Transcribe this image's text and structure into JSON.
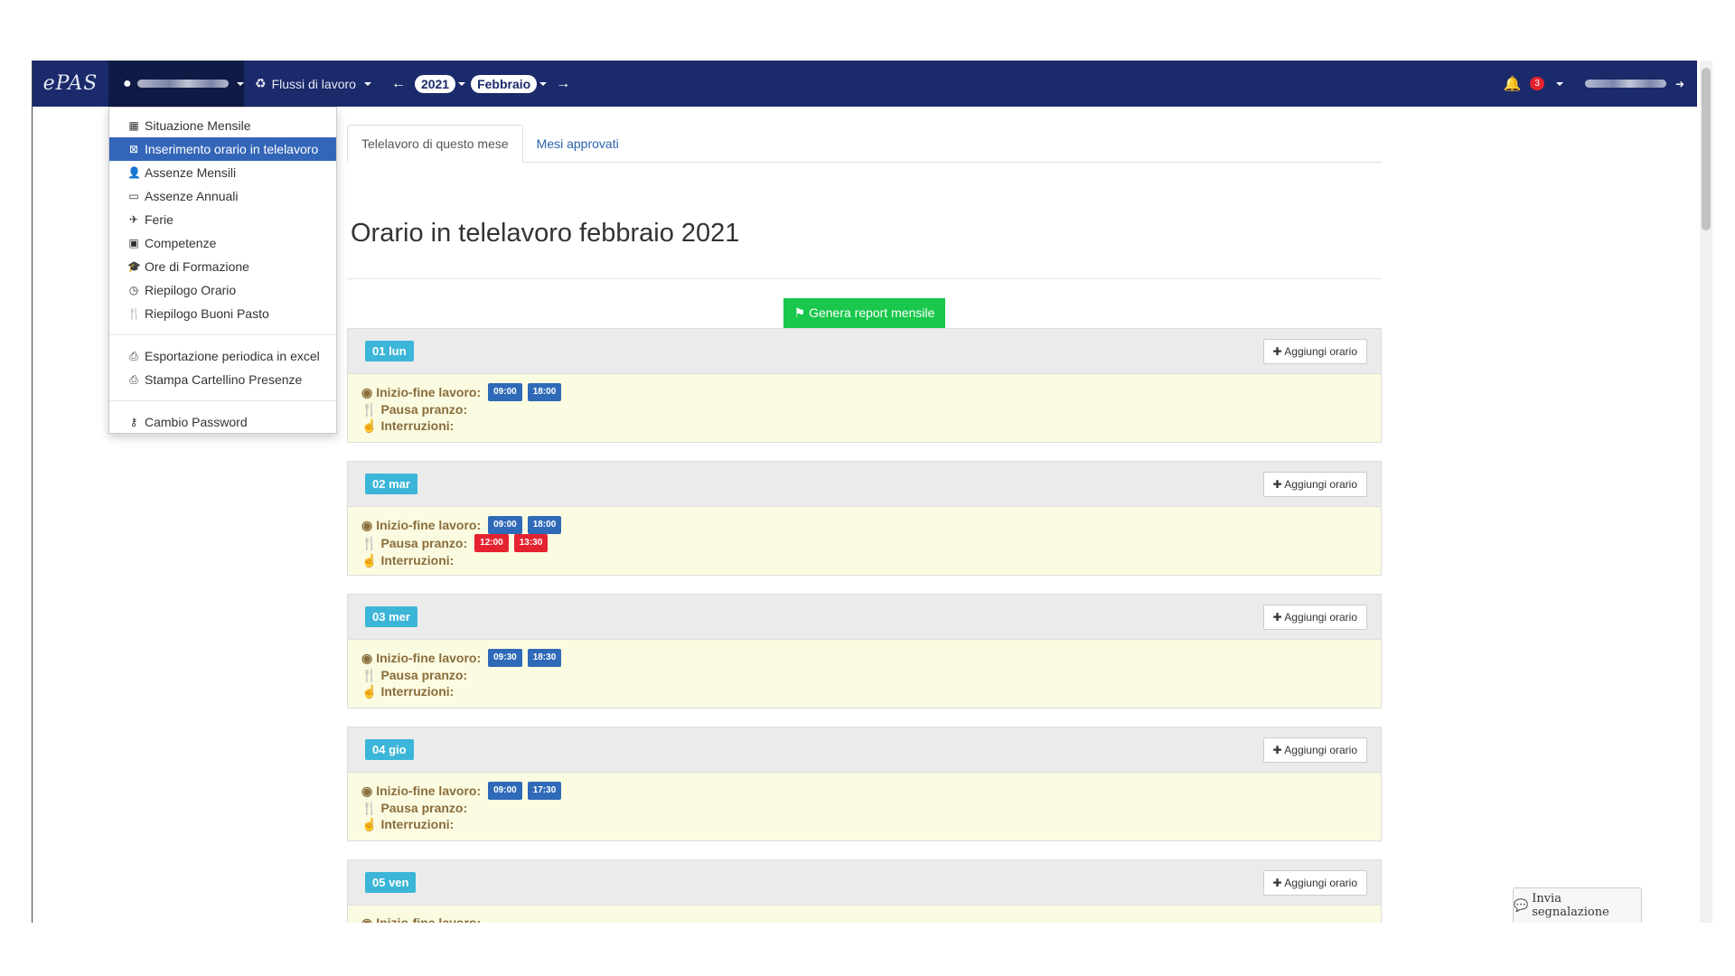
{
  "navbar": {
    "brand": "ePAS",
    "workflows_label": "Flussi di lavoro",
    "year": "2021",
    "month": "Febbraio",
    "notifications_count": "3"
  },
  "dropdown": {
    "items": [
      {
        "label": "Situazione Mensile",
        "icon": "calendar-icon"
      },
      {
        "label": "Inserimento orario in telelavoro",
        "icon": "calendar-x-icon",
        "active": true
      },
      {
        "label": "Assenze Mensili",
        "icon": "user-x-icon"
      },
      {
        "label": "Assenze Annuali",
        "icon": "calendar-empty-icon"
      },
      {
        "label": "Ferie",
        "icon": "plane-icon"
      },
      {
        "label": "Competenze",
        "icon": "money-icon"
      },
      {
        "label": "Ore di Formazione",
        "icon": "graduation-cap-icon"
      },
      {
        "label": "Riepilogo Orario",
        "icon": "clock-icon"
      },
      {
        "label": "Riepilogo Buoni Pasto",
        "icon": "cutlery-icon"
      },
      {
        "label": "Esportazione periodica in excel",
        "icon": "print-icon"
      },
      {
        "label": "Stampa Cartellino Presenze",
        "icon": "print-icon"
      },
      {
        "label": "Cambio Password",
        "icon": "key-icon"
      }
    ]
  },
  "tabs": [
    "Telelavoro di questo mese",
    "Mesi approvati"
  ],
  "title": "Orario in telelavoro febbraio 2021",
  "report_button": "Genera report mensile",
  "add_button": "Aggiungi orario",
  "labels": {
    "work": "Inizio-fine lavoro:",
    "lunch": "Pausa pranzo:",
    "breaks": "Interruzioni:"
  },
  "days": [
    {
      "label": "01 lun",
      "work": [
        "09:00",
        "18:00"
      ],
      "lunch": []
    },
    {
      "label": "02 mar",
      "work": [
        "09:00",
        "18:00"
      ],
      "lunch": [
        "12:00",
        "13:30"
      ]
    },
    {
      "label": "03 mer",
      "work": [
        "09:30",
        "18:30"
      ],
      "lunch": []
    },
    {
      "label": "04 gio",
      "work": [
        "09:00",
        "17:30"
      ],
      "lunch": []
    },
    {
      "label": "05 ven",
      "work": [],
      "lunch": []
    }
  ],
  "report_issue": "Invia segnalazione",
  "colors": {
    "navbar": "#1b2a6b",
    "active_item": "#3366b8",
    "report_button": "#18c74b",
    "day_badge": "#3bb6d8",
    "time_tag": "#2f6ab8",
    "lunch_tag": "#e52330"
  }
}
